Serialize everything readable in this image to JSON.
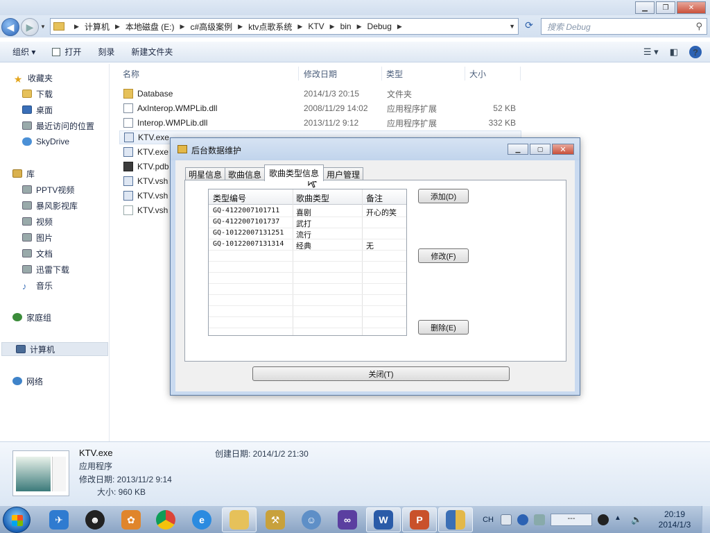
{
  "explorer": {
    "breadcrumbs": [
      "计算机",
      "本地磁盘 (E:)",
      "c#高级案例",
      "ktv点歌系统",
      "KTV",
      "bin",
      "Debug"
    ],
    "search_placeholder": "搜索 Debug",
    "toolbar": {
      "organize": "组织 ▾",
      "open": "打开",
      "burn": "刻录",
      "new_folder": "新建文件夹"
    },
    "nav": {
      "favorites": "收藏夹",
      "downloads": "下载",
      "desktop": "桌面",
      "recent": "最近访问的位置",
      "skydrive": "SkyDrive",
      "libraries": "库",
      "pptv": "PPTV视频",
      "baofeng": "暴风影视库",
      "videos": "视频",
      "pictures": "图片",
      "documents": "文档",
      "xunlei": "迅雷下载",
      "music": "音乐",
      "homegroup": "家庭组",
      "computer": "计算机",
      "network": "网络"
    },
    "columns": {
      "name": "名称",
      "date": "修改日期",
      "type": "类型",
      "size": "大小"
    },
    "files": [
      {
        "name": "Database",
        "date": "2014/1/3 20:15",
        "type": "文件夹",
        "size": "",
        "icon": "folder-icon"
      },
      {
        "name": "AxInterop.WMPLib.dll",
        "date": "2008/11/29 14:02",
        "type": "应用程序扩展",
        "size": "52 KB",
        "icon": "dll-icon"
      },
      {
        "name": "Interop.WMPLib.dll",
        "date": "2013/11/2 9:12",
        "type": "应用程序扩展",
        "size": "332 KB",
        "icon": "dll-icon"
      },
      {
        "name": "KTV.exe",
        "date": "",
        "type": "",
        "size": "",
        "icon": "exe-icon"
      },
      {
        "name": "KTV.exe",
        "date": "",
        "type": "",
        "size": "",
        "icon": "exe-icon"
      },
      {
        "name": "KTV.pdb",
        "date": "",
        "type": "",
        "size": "",
        "icon": "pdb-icon"
      },
      {
        "name": "KTV.vsh",
        "date": "",
        "type": "",
        "size": "",
        "icon": "exe-icon"
      },
      {
        "name": "KTV.vsh",
        "date": "",
        "type": "",
        "size": "",
        "icon": "exe-icon"
      },
      {
        "name": "KTV.vsh",
        "date": "",
        "type": "",
        "size": "",
        "icon": "file-icon"
      }
    ],
    "details": {
      "name": "KTV.exe",
      "kind": "应用程序",
      "modified": "修改日期: 2013/11/2 9:14",
      "size": "大小: 960 KB",
      "created": "创建日期: 2014/1/2 21:30"
    }
  },
  "dialog": {
    "title": "后台数据维护",
    "tabs": [
      "明星信息",
      "歌曲信息",
      "歌曲类型信息",
      "用户管理"
    ],
    "active_tab": 2,
    "grid": {
      "headers": [
        "类型编号",
        "歌曲类型",
        "备注"
      ],
      "rows": [
        [
          "GQ-4122007101711",
          "喜剧",
          "开心的笑"
        ],
        [
          "GQ-4122007101737",
          "武打",
          ""
        ],
        [
          "GQ-10122007131251",
          "流行",
          ""
        ],
        [
          "GQ-10122007131314",
          "经典",
          "无"
        ]
      ]
    },
    "buttons": {
      "add": "添加(D)",
      "edit": "修改(F)",
      "delete": "删除(E)",
      "close": "关闭(T)"
    }
  },
  "taskbar": {
    "ime": "CH",
    "tray_box": "---",
    "time": "20:19",
    "date": "2014/1/3"
  }
}
